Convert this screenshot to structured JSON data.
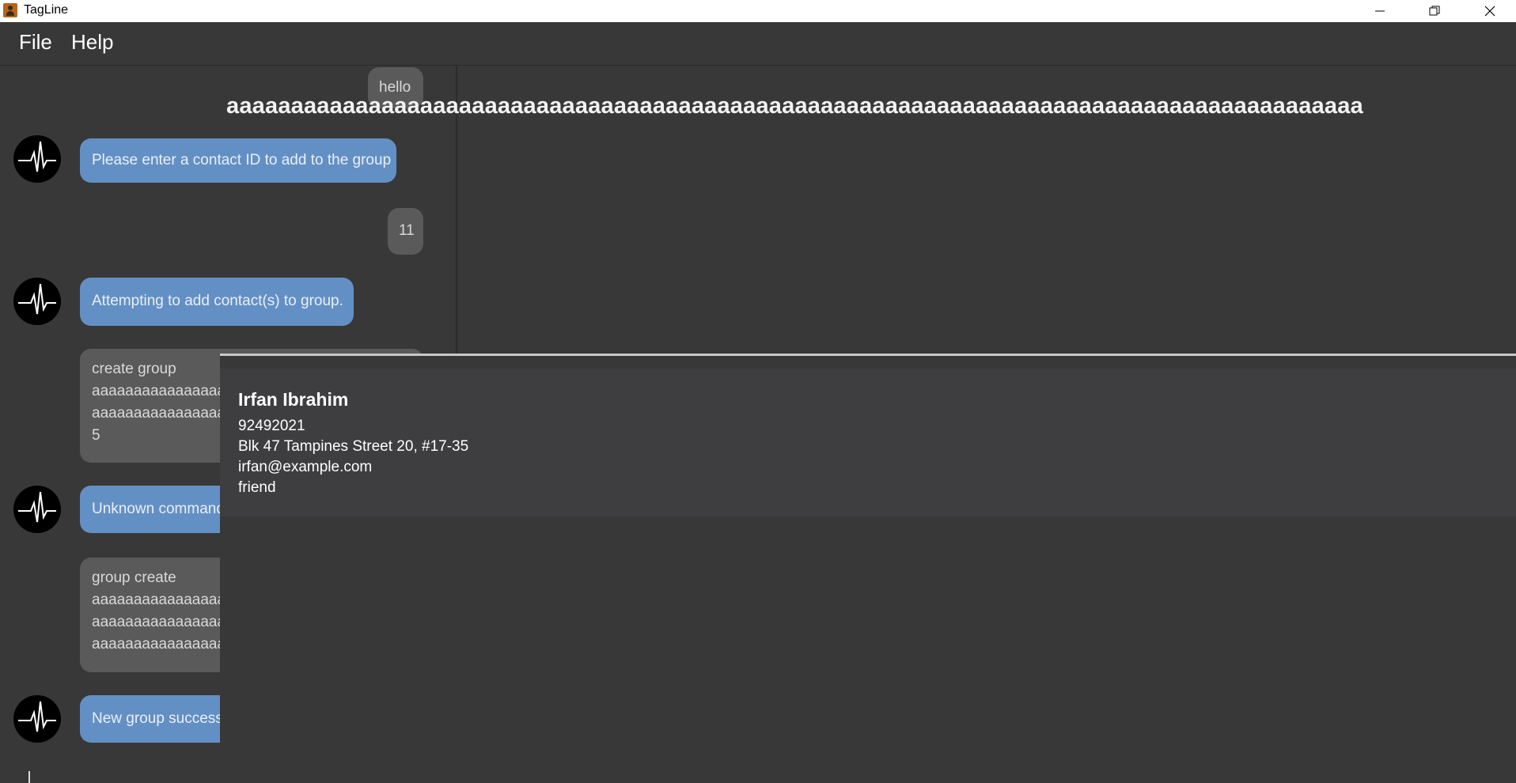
{
  "window": {
    "title": "TagLine",
    "controls": {
      "minimize": "—",
      "restore": "❐",
      "close": "✕"
    }
  },
  "menu": {
    "file": "File",
    "help": "Help"
  },
  "chat": {
    "overflow_text": "aaaaaaaaaaaaaaaaaaaaaaaaaaaaaaaaaaaaaaaaaaaaaaaaaaaaaaaaaaaaaaaaaaaaaaaaaaaaaaaaaaaaaaaa",
    "messages": [
      {
        "from": "user",
        "lines": [
          "hello"
        ]
      },
      {
        "from": "bot",
        "lines": [
          "Please enter a contact ID to add to the group"
        ]
      },
      {
        "from": "user",
        "lines": [
          "11"
        ]
      },
      {
        "from": "bot",
        "lines": [
          "Attempting to add contact(s) to group."
        ]
      },
      {
        "from": "user",
        "lines": [
          "create group",
          "aaaaaaaaaaaaaaaa",
          "aaaaaaaaaaaaaaaa",
          "5"
        ]
      },
      {
        "from": "bot",
        "lines": [
          "Unknown command"
        ]
      },
      {
        "from": "user",
        "lines": [
          "group create",
          "aaaaaaaaaaaaaaaa",
          "aaaaaaaaaaaaaaaa",
          "aaaaaaaaaaaaaaaa"
        ]
      },
      {
        "from": "bot",
        "lines": [
          "New group success"
        ]
      }
    ]
  },
  "contact": {
    "name": "Irfan Ibrahim",
    "phone": "92492021",
    "address": "Blk 47 Tampines Street 20, #17-35",
    "email": "irfan@example.com",
    "tag": "friend"
  },
  "colors": {
    "background": "#383838",
    "bot_bubble": "#6390c4",
    "user_bubble": "#5a5a5a",
    "card": "#3e3e41"
  },
  "icons": {
    "bot_avatar": "heartbeat-icon",
    "app": "tagline-app-icon"
  }
}
